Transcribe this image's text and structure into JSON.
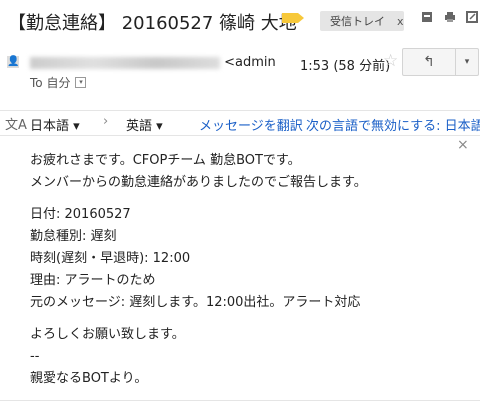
{
  "header": {
    "subject": "【勤怠連絡】 20160527 篠崎 大地",
    "label_chip": "受信トレイ",
    "label_close": "x",
    "icons": [
      "archive-icon",
      "print-icon",
      "new-window-icon"
    ]
  },
  "message": {
    "sender_suffix": "<admin",
    "time": "1:53 (58 分前)",
    "to": "To 自分",
    "star": "☆",
    "reply_glyph": "↰",
    "more_glyph": "▾"
  },
  "translate_bar": {
    "source_lang": "日本語 ▾",
    "target_lang": "英語 ▾",
    "translate_link": "メッセージを翻訳",
    "disable_link": "次の言語で無効にする: 日本語"
  },
  "body": {
    "l1": "お疲れさまです。CFOPチーム 勤怠BOTです。",
    "l2": "メンバーからの勤怠連絡がありましたのでご報告します。",
    "l3": "日付: 20160527",
    "l4": "勤怠種別: 遅刻",
    "l5": "時刻(遅刻・早退時): 12:00",
    "l6": "理由: アラートのため",
    "l7": "元のメッセージ: 遅刻します。12:00出社。アラート対応",
    "l8": "よろしくお願い致します。",
    "l9": "--",
    "l10": "親愛なるBOTより。"
  }
}
